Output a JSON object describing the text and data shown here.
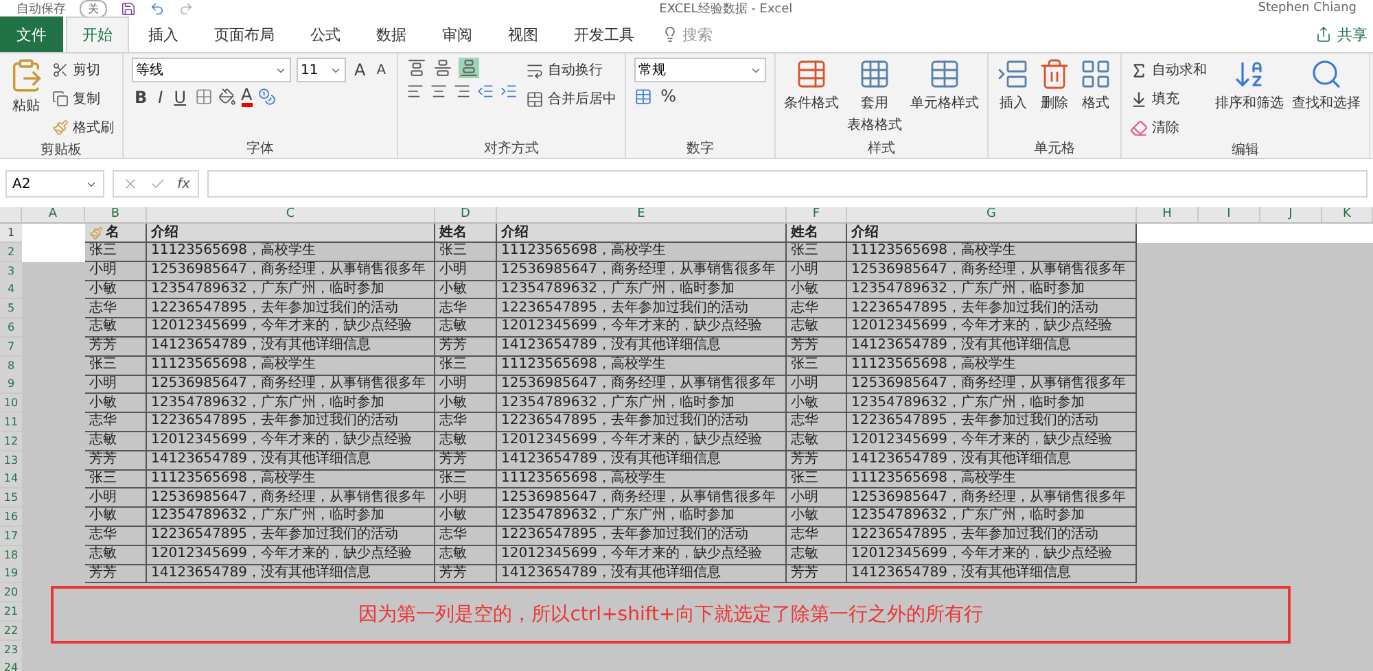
{
  "title_bar": {
    "autosave_label": "自动保存",
    "autosave_state": "关",
    "title": "EXCEL经验数据 - Excel",
    "user": "Stephen Chiang"
  },
  "tabs": [
    {
      "label": "文件",
      "kind": "file",
      "selected": false
    },
    {
      "label": "开始",
      "kind": "tab",
      "selected": true
    },
    {
      "label": "插入",
      "kind": "tab",
      "selected": false
    },
    {
      "label": "页面布局",
      "kind": "tab",
      "selected": false
    },
    {
      "label": "公式",
      "kind": "tab",
      "selected": false
    },
    {
      "label": "数据",
      "kind": "tab",
      "selected": false
    },
    {
      "label": "审阅",
      "kind": "tab",
      "selected": false
    },
    {
      "label": "视图",
      "kind": "tab",
      "selected": false
    },
    {
      "label": "开发工具",
      "kind": "tab",
      "selected": false
    }
  ],
  "search": {
    "placeholder": "搜索"
  },
  "share": "共享",
  "ribbon": [
    {
      "kind": "clipboard",
      "label": "剪贴板",
      "paste": "粘贴",
      "cut": "剪切",
      "copy": "复制",
      "painter": "格式刷"
    },
    {
      "kind": "font",
      "label": "字体",
      "font_name": "等线",
      "font_size": "11",
      "grow": "A",
      "shrink": "A",
      "style_buttons": [
        "B",
        "I",
        "U"
      ],
      "font_color": "A"
    },
    {
      "kind": "alignment",
      "label": "对齐方式",
      "vertical_align": [
        {
          "selected": false
        },
        {
          "selected": false
        },
        {
          "selected": true
        }
      ],
      "wrap": "自动换行",
      "merge": "合并后居中"
    },
    {
      "kind": "number",
      "label": "数字",
      "format": "常规",
      "percent": "%"
    },
    {
      "kind": "styles",
      "label": "样式",
      "buttons": [
        [
          "条件格式"
        ],
        [
          "套用",
          "表格格式"
        ],
        [
          "单元格样式"
        ]
      ]
    },
    {
      "kind": "cells",
      "label": "单元格",
      "buttons": [
        "插入",
        "删除",
        "格式"
      ]
    },
    {
      "kind": "editing",
      "label": "编辑",
      "small": [
        "自动求和",
        "填充",
        "清除"
      ],
      "large": [
        "排序和筛选",
        "查找和选择"
      ]
    }
  ],
  "formula_bar": {
    "name_box": "A2",
    "fx": "fx"
  },
  "sheet": {
    "columns": [
      "A",
      "B",
      "C",
      "D",
      "E",
      "F",
      "G",
      "H",
      "I",
      "J",
      "K"
    ],
    "rows": [
      {
        "number": "1",
        "selected": false,
        "cells": [
          "名",
          "介绍",
          "姓名",
          "介绍",
          "姓名",
          "介绍"
        ]
      },
      {
        "number": "2",
        "selected": true,
        "active": true,
        "cells": [
          "张三",
          "11123565698，高校学生",
          "张三",
          "11123565698，高校学生",
          "张三",
          "11123565698，高校学生"
        ]
      },
      {
        "number": "3",
        "selected": true,
        "cells": [
          "小明",
          "12536985647，商务经理，从事销售很多年",
          "小明",
          "12536985647，商务经理，从事销售很多年",
          "小明",
          "12536985647，商务经理，从事销售很多年"
        ]
      },
      {
        "number": "4",
        "selected": true,
        "cells": [
          "小敏",
          "12354789632，广东广州，临时参加",
          "小敏",
          "12354789632，广东广州，临时参加",
          "小敏",
          "12354789632，广东广州，临时参加"
        ]
      },
      {
        "number": "5",
        "selected": true,
        "cells": [
          "志华",
          "12236547895，去年参加过我们的活动",
          "志华",
          "12236547895，去年参加过我们的活动",
          "志华",
          "12236547895，去年参加过我们的活动"
        ]
      },
      {
        "number": "6",
        "selected": true,
        "cells": [
          "志敏",
          "12012345699，今年才来的，缺少点经验",
          "志敏",
          "12012345699，今年才来的，缺少点经验",
          "志敏",
          "12012345699，今年才来的，缺少点经验"
        ]
      },
      {
        "number": "7",
        "selected": true,
        "cells": [
          "芳芳",
          "14123654789，没有其他详细信息",
          "芳芳",
          "14123654789，没有其他详细信息",
          "芳芳",
          "14123654789，没有其他详细信息"
        ]
      },
      {
        "number": "8",
        "selected": true,
        "cells": [
          "张三",
          "11123565698，高校学生",
          "张三",
          "11123565698，高校学生",
          "张三",
          "11123565698，高校学生"
        ]
      },
      {
        "number": "9",
        "selected": true,
        "cells": [
          "小明",
          "12536985647，商务经理，从事销售很多年",
          "小明",
          "12536985647，商务经理，从事销售很多年",
          "小明",
          "12536985647，商务经理，从事销售很多年"
        ]
      },
      {
        "number": "10",
        "selected": true,
        "cells": [
          "小敏",
          "12354789632，广东广州，临时参加",
          "小敏",
          "12354789632，广东广州，临时参加",
          "小敏",
          "12354789632，广东广州，临时参加"
        ]
      },
      {
        "number": "11",
        "selected": true,
        "cells": [
          "志华",
          "12236547895，去年参加过我们的活动",
          "志华",
          "12236547895，去年参加过我们的活动",
          "志华",
          "12236547895，去年参加过我们的活动"
        ]
      },
      {
        "number": "12",
        "selected": true,
        "cells": [
          "志敏",
          "12012345699，今年才来的，缺少点经验",
          "志敏",
          "12012345699，今年才来的，缺少点经验",
          "志敏",
          "12012345699，今年才来的，缺少点经验"
        ]
      },
      {
        "number": "13",
        "selected": true,
        "cells": [
          "芳芳",
          "14123654789，没有其他详细信息",
          "芳芳",
          "14123654789，没有其他详细信息",
          "芳芳",
          "14123654789，没有其他详细信息"
        ]
      },
      {
        "number": "14",
        "selected": true,
        "cells": [
          "张三",
          "11123565698，高校学生",
          "张三",
          "11123565698，高校学生",
          "张三",
          "11123565698，高校学生"
        ]
      },
      {
        "number": "15",
        "selected": true,
        "cells": [
          "小明",
          "12536985647，商务经理，从事销售很多年",
          "小明",
          "12536985647，商务经理，从事销售很多年",
          "小明",
          "12536985647，商务经理，从事销售很多年"
        ]
      },
      {
        "number": "16",
        "selected": true,
        "cells": [
          "小敏",
          "12354789632，广东广州，临时参加",
          "小敏",
          "12354789632，广东广州，临时参加",
          "小敏",
          "12354789632，广东广州，临时参加"
        ]
      },
      {
        "number": "17",
        "selected": true,
        "cells": [
          "志华",
          "12236547895，去年参加过我们的活动",
          "志华",
          "12236547895，去年参加过我们的活动",
          "志华",
          "12236547895，去年参加过我们的活动"
        ]
      },
      {
        "number": "18",
        "selected": true,
        "cells": [
          "志敏",
          "12012345699，今年才来的，缺少点经验",
          "志敏",
          "12012345699，今年才来的，缺少点经验",
          "志敏",
          "12012345699，今年才来的，缺少点经验"
        ]
      },
      {
        "number": "19",
        "selected": true,
        "cells": [
          "芳芳",
          "14123654789，没有其他详细信息",
          "芳芳",
          "14123654789，没有其他详细信息",
          "芳芳",
          "14123654789，没有其他详细信息"
        ]
      },
      {
        "number": "20",
        "selected": true
      },
      {
        "number": "21",
        "selected": true
      },
      {
        "number": "22",
        "selected": true
      },
      {
        "number": "23",
        "selected": true
      },
      {
        "number": "24",
        "selected": true
      }
    ]
  },
  "annotation": {
    "text": "因为第一列是空的，所以ctrl+shift+向下就选定了除第一行之外的所有行"
  }
}
